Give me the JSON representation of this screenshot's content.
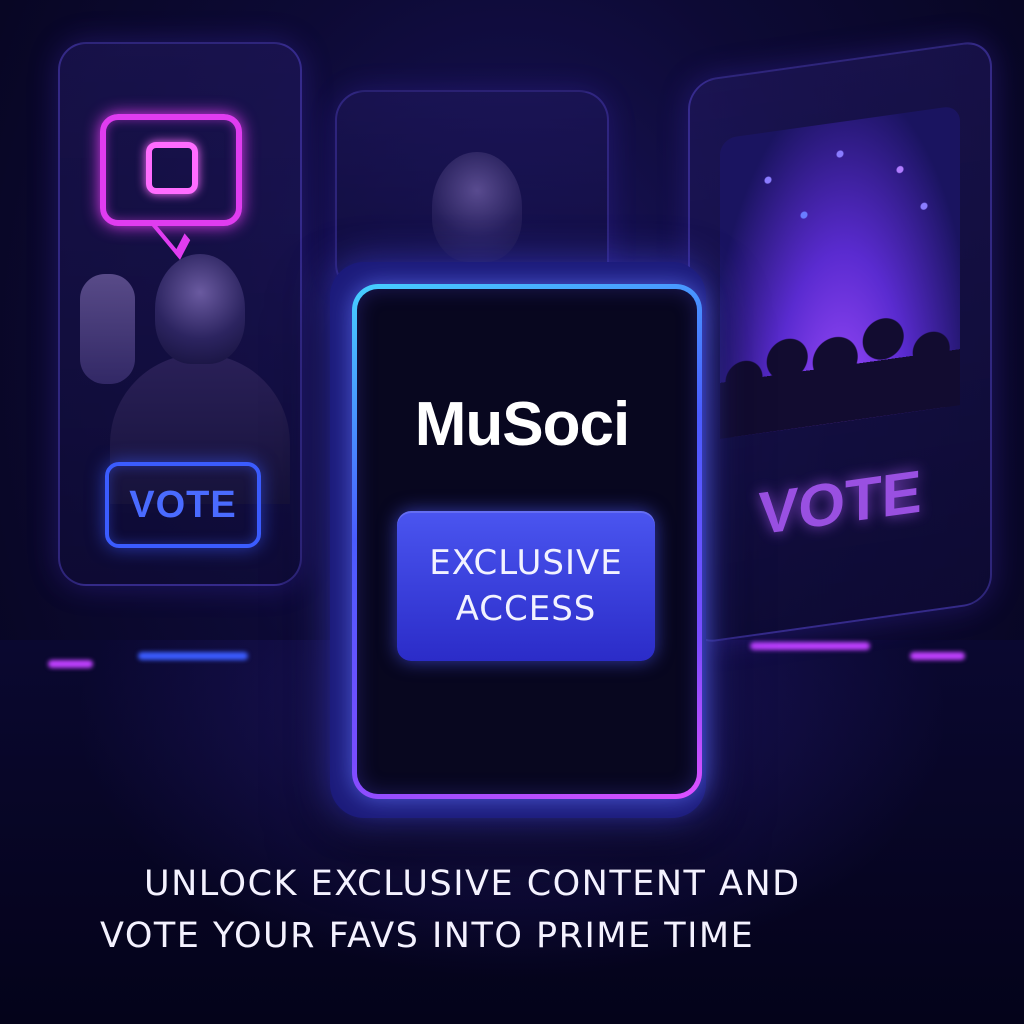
{
  "brand": {
    "name": "MuSoci"
  },
  "main_card": {
    "button_line1": "EXCLUSIVE",
    "button_line2": "ACCESS"
  },
  "left_card": {
    "vote_label": "VOTE"
  },
  "right_card": {
    "vote_label": "VOTE"
  },
  "tagline": {
    "line1": "UNLOCK EXCLUSIVE CONTENT AND",
    "line2": "VOTE YOUR FAVS INTO PRIME TIME"
  },
  "colors": {
    "background": "#0d0a35",
    "accent_blue": "#3b5cff",
    "accent_magenta": "#e03cf0",
    "button": "#3a40e0",
    "text": "#ffffff"
  },
  "icons": [
    "chat-bubble-icon"
  ]
}
